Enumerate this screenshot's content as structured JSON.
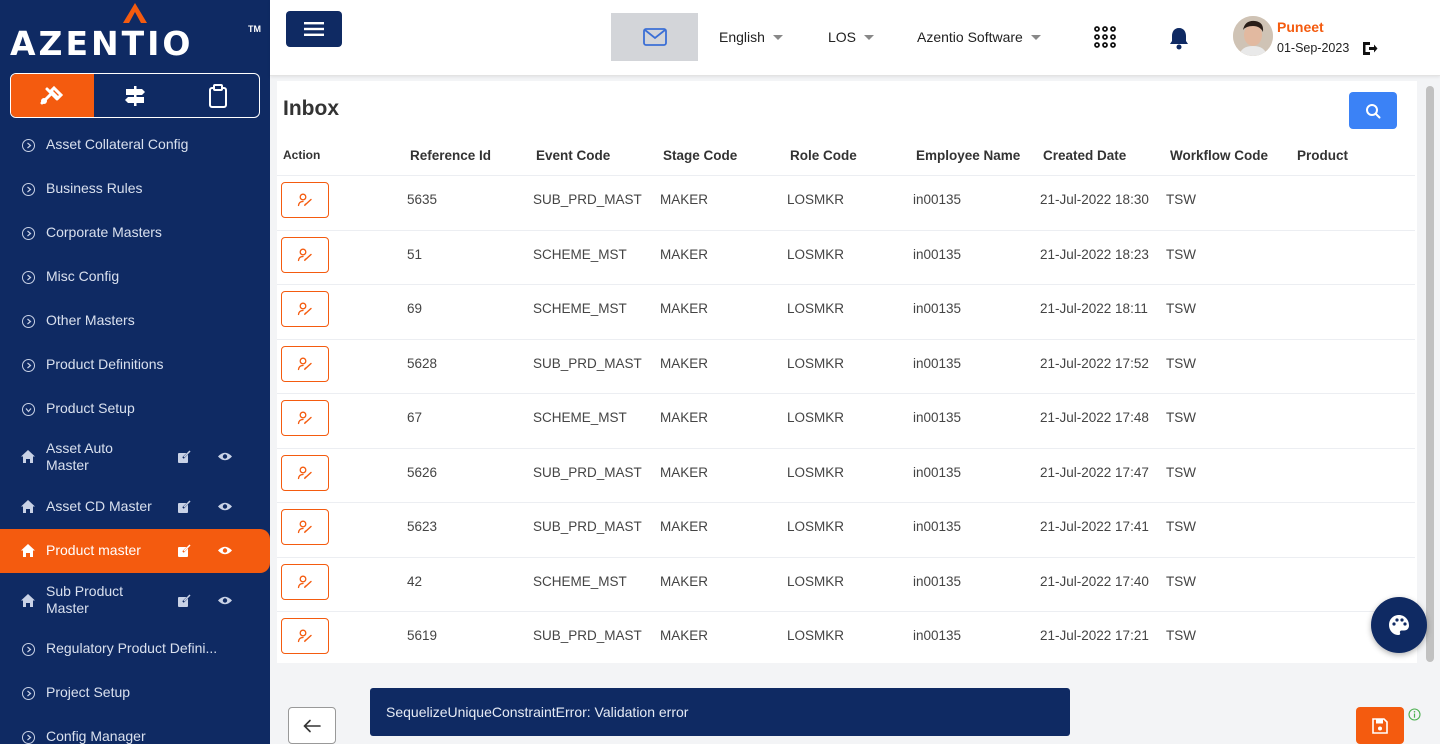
{
  "brand": {
    "logo_text": "AZENTIO",
    "tm": "TM"
  },
  "sidebar": {
    "items": [
      {
        "label": "Asset Collateral Config",
        "kind": "section"
      },
      {
        "label": "Business Rules",
        "kind": "section"
      },
      {
        "label": "Corporate Masters",
        "kind": "section"
      },
      {
        "label": "Misc Config",
        "kind": "section"
      },
      {
        "label": "Other Masters",
        "kind": "section"
      },
      {
        "label": "Product Definitions",
        "kind": "section"
      },
      {
        "label": "Product Setup",
        "kind": "section-open"
      },
      {
        "label": "Asset Auto Master",
        "kind": "page"
      },
      {
        "label": "Asset CD Master",
        "kind": "page"
      },
      {
        "label": "Product master",
        "kind": "page",
        "active": true
      },
      {
        "label": "Sub Product Master",
        "kind": "page"
      },
      {
        "label": "Regulatory Product Defini...",
        "kind": "section"
      },
      {
        "label": "Project Setup",
        "kind": "section"
      },
      {
        "label": "Config Manager",
        "kind": "section"
      }
    ]
  },
  "header": {
    "language": "English",
    "module": "LOS",
    "entity": "Azentio Software",
    "user_name": "Puneet",
    "user_date": "01-Sep-2023"
  },
  "inbox": {
    "title": "Inbox",
    "columns": [
      "Action",
      "Reference Id",
      "Event Code",
      "Stage Code",
      "Role Code",
      "Employee Name",
      "Created Date",
      "Workflow Code",
      "Product"
    ],
    "rows": [
      [
        "5635",
        "SUB_PRD_MAST",
        "MAKER",
        "LOSMKR",
        "in00135",
        "21-Jul-2022 18:30",
        "TSW",
        ""
      ],
      [
        "51",
        "SCHEME_MST",
        "MAKER",
        "LOSMKR",
        "in00135",
        "21-Jul-2022 18:23",
        "TSW",
        ""
      ],
      [
        "69",
        "SCHEME_MST",
        "MAKER",
        "LOSMKR",
        "in00135",
        "21-Jul-2022 18:11",
        "TSW",
        ""
      ],
      [
        "5628",
        "SUB_PRD_MAST",
        "MAKER",
        "LOSMKR",
        "in00135",
        "21-Jul-2022 17:52",
        "TSW",
        ""
      ],
      [
        "67",
        "SCHEME_MST",
        "MAKER",
        "LOSMKR",
        "in00135",
        "21-Jul-2022 17:48",
        "TSW",
        ""
      ],
      [
        "5626",
        "SUB_PRD_MAST",
        "MAKER",
        "LOSMKR",
        "in00135",
        "21-Jul-2022 17:47",
        "TSW",
        ""
      ],
      [
        "5623",
        "SUB_PRD_MAST",
        "MAKER",
        "LOSMKR",
        "in00135",
        "21-Jul-2022 17:41",
        "TSW",
        ""
      ],
      [
        "42",
        "SCHEME_MST",
        "MAKER",
        "LOSMKR",
        "in00135",
        "21-Jul-2022 17:40",
        "TSW",
        ""
      ],
      [
        "5619",
        "SUB_PRD_MAST",
        "MAKER",
        "LOSMKR",
        "in00135",
        "21-Jul-2022 17:21",
        "TSW",
        ""
      ]
    ]
  },
  "toast": {
    "message": "SequelizeUniqueConstraintError: Validation error"
  },
  "colors": {
    "navy": "#0f2a63",
    "accent": "#f45b0f",
    "search_blue": "#3b82f6"
  },
  "icons": [
    "menu-icon",
    "mail-icon",
    "apps-grid-icon",
    "bell-icon",
    "logout-icon",
    "search-icon",
    "assign-icon",
    "back-arrow-icon",
    "palette-icon",
    "save-icon",
    "info-icon",
    "home-icon",
    "edit-icon",
    "eye-icon",
    "tools-icon",
    "signpost-icon",
    "clipboard-icon"
  ]
}
